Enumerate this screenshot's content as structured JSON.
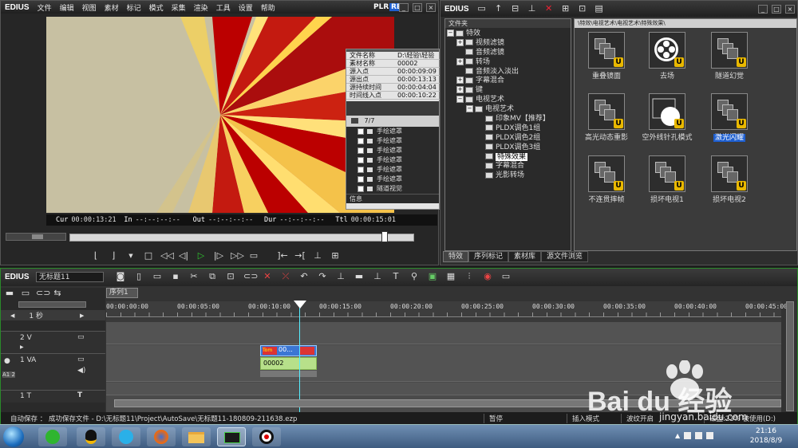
{
  "preview": {
    "app": "EDIUS",
    "menu": [
      "文件",
      "编辑",
      "视图",
      "素材",
      "标记",
      "模式",
      "采集",
      "渲染",
      "工具",
      "设置",
      "帮助"
    ],
    "plr": "PLR",
    "rec": "REC",
    "timecodes": {
      "cur_label": "Cur",
      "cur": "00:00:13:21",
      "in_label": "In",
      "in": "--:--:--:--",
      "out_label": "Out",
      "out": "--:--:--:--",
      "dur_label": "Dur",
      "dur": "--:--:--:--",
      "ttl_label": "Ttl",
      "ttl": "00:00:15:01"
    }
  },
  "info": {
    "rows": [
      {
        "k": "文件名称",
        "v": "D:\\轻验\\轻验"
      },
      {
        "k": "素材名称",
        "v": "00002"
      },
      {
        "k": "源入点",
        "v": "00:00:09:09"
      },
      {
        "k": "源出点",
        "v": "00:00:13:13"
      },
      {
        "k": "源持续时间",
        "v": "00:00:04:04"
      },
      {
        "k": "时间线入点",
        "v": "00:00:10:22"
      }
    ],
    "count": "7/7",
    "effects": [
      "手绘遮罩",
      "手绘遮罩",
      "手绘遮罩",
      "手绘遮罩",
      "手绘遮罩",
      "手绘遮罩",
      "隧道视觉"
    ],
    "tab": "信息"
  },
  "effects_panel": {
    "app": "EDIUS",
    "tree_title": "文件夹",
    "path": "\\特效\\电视艺术\\电视艺术\\特殊效果\\",
    "tree": [
      {
        "indent": 0,
        "box": "−",
        "label": "特效"
      },
      {
        "indent": 1,
        "box": "+",
        "label": "视频滤镜"
      },
      {
        "indent": 1,
        "box": "",
        "label": "音频滤镜"
      },
      {
        "indent": 1,
        "box": "+",
        "label": "转场"
      },
      {
        "indent": 1,
        "box": "",
        "label": "音频淡入淡出"
      },
      {
        "indent": 1,
        "box": "+",
        "label": "字幕混合"
      },
      {
        "indent": 1,
        "box": "+",
        "label": "键"
      },
      {
        "indent": 1,
        "box": "−",
        "label": "电视艺术"
      },
      {
        "indent": 2,
        "box": "−",
        "label": "电视艺术"
      },
      {
        "indent": 3,
        "box": "",
        "label": "印象MV【推荐】"
      },
      {
        "indent": 3,
        "box": "",
        "label": "PLDX调色1组"
      },
      {
        "indent": 3,
        "box": "",
        "label": "PLDX调色2组"
      },
      {
        "indent": 3,
        "box": "",
        "label": "PLDX调色3组"
      },
      {
        "indent": 3,
        "box": "",
        "label": "特殊效果",
        "selected": true
      },
      {
        "indent": 3,
        "box": "",
        "label": "字幕混合"
      },
      {
        "indent": 3,
        "box": "",
        "label": "光影转场"
      }
    ],
    "items": [
      "重叠镜面",
      "去场",
      "隧道幻觉",
      "高光动态重影",
      "空外线针孔模式",
      "激光闪耀",
      "不连贯摔帧",
      "损坏电视1",
      "损坏电视2"
    ],
    "selected_item": "激光闪耀",
    "tabs": [
      "特效",
      "序列标记",
      "素材库",
      "源文件浏览"
    ]
  },
  "timeline": {
    "app": "EDIUS",
    "project": "无标题11",
    "sequence_tab": "序列1",
    "scale": "1 秒",
    "ruler": [
      "00:00:00:00",
      "00:00:05:00",
      "00:00:10:00",
      "00:00:15:00",
      "00:00:20:00",
      "00:00:25:00",
      "00:00:30:00",
      "00:00:35:00",
      "00:00:40:00",
      "00:00:45:00"
    ],
    "tracks": [
      {
        "name": "2 V"
      },
      {
        "name": "1 VA"
      },
      {
        "name": "1 T"
      }
    ],
    "clip_label": "00002",
    "clip_title": "00...",
    "a_label": "A1 2"
  },
  "status": {
    "autosave": "自动保存 ： 成功保存文件 - D:\\无标题11\\Project\\AutoSave\\无标题11-180809-211638.ezp",
    "pause": "暂停",
    "mode": "插入模式",
    "ripple": "波纹开启",
    "disk": "磁盘:23% 被使用(D:)"
  },
  "taskbar": {
    "time": "21:16",
    "date": "2018/8/9"
  },
  "watermark": {
    "brand": "Bai du 经验",
    "url": "jingyan.baidu.com"
  },
  "colors": {
    "accent": "#00a000",
    "select": "#1e5fd0",
    "clip_green": "#b7e08a"
  }
}
